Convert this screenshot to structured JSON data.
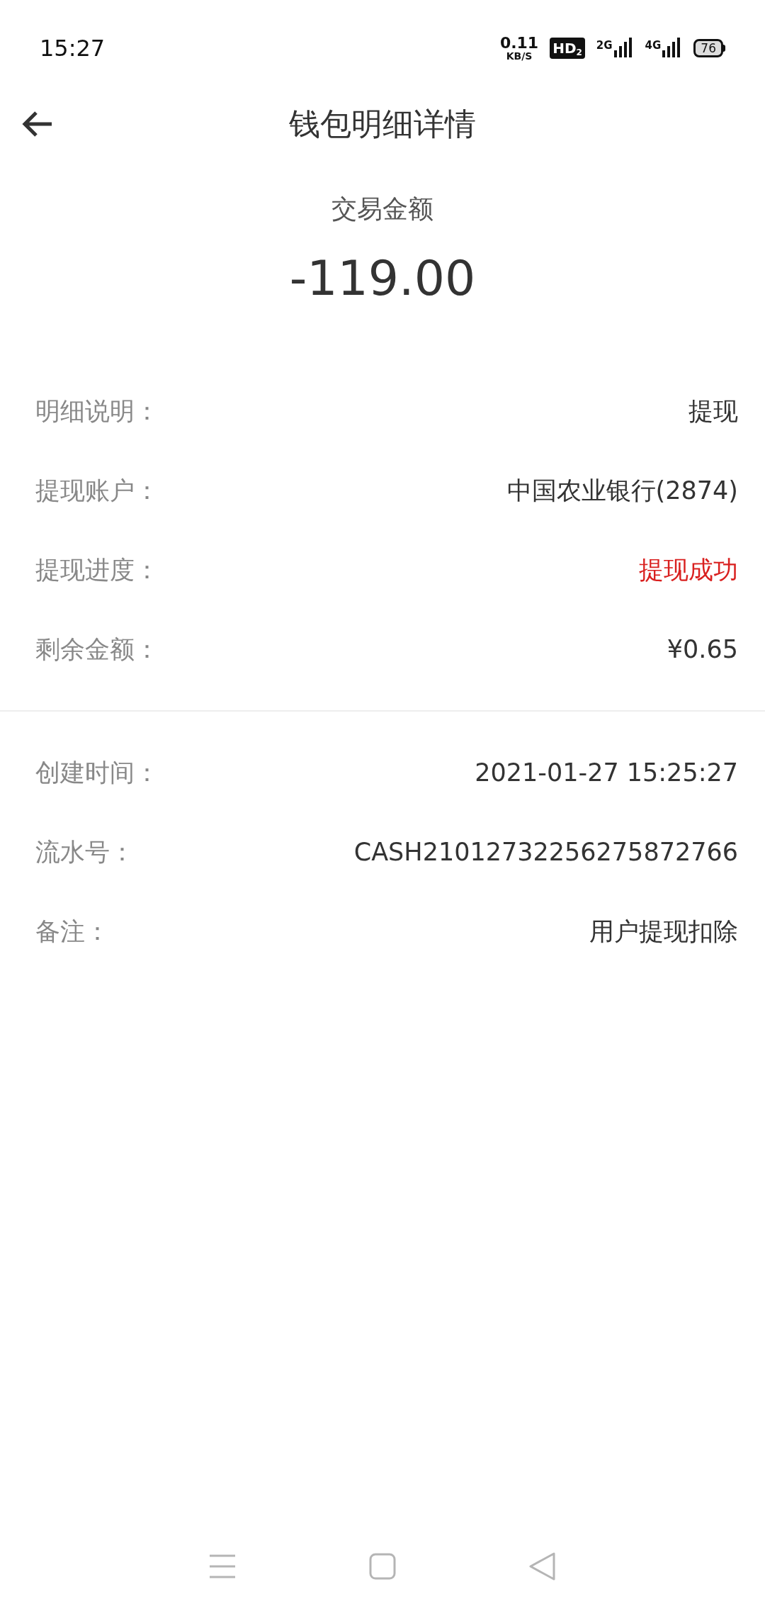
{
  "status_bar": {
    "time": "15:27",
    "speed_value": "0.11",
    "speed_unit": "KB/S",
    "hd": "HD",
    "hd_sub": "2",
    "sim1": "2G",
    "sim2": "4G",
    "battery": "76"
  },
  "header": {
    "title": "钱包明细详情"
  },
  "amount": {
    "label": "交易金额",
    "value": "-119.00"
  },
  "sections": [
    {
      "rows": [
        {
          "label": "明细说明：",
          "value": "提现",
          "kind": "normal"
        },
        {
          "label": "提现账户：",
          "value": "中国农业银行(2874)",
          "kind": "normal"
        },
        {
          "label": "提现进度：",
          "value": "提现成功",
          "kind": "status"
        },
        {
          "label": "剩余金额：",
          "value": "¥0.65",
          "kind": "normal"
        }
      ]
    },
    {
      "rows": [
        {
          "label": "创建时间：",
          "value": "2021-01-27 15:25:27",
          "kind": "normal"
        },
        {
          "label": "流水号：",
          "value": "CASH21012732256275872766",
          "kind": "normal"
        },
        {
          "label": "备注：",
          "value": "用户提现扣除",
          "kind": "normal"
        }
      ]
    }
  ]
}
